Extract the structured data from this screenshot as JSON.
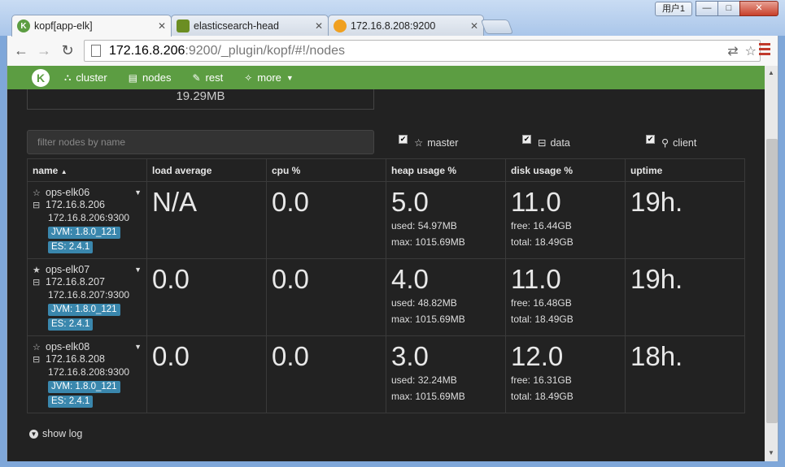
{
  "window": {
    "user_badge": "用户1",
    "minimize": "—",
    "maximize": "□",
    "close": "✕"
  },
  "tabs": [
    {
      "label": "kopf[app-elk]",
      "fav": "K",
      "fav_color": "#5c9d42"
    },
    {
      "label": "elasticsearch-head",
      "fav": "",
      "fav_color": "#6b8e23"
    },
    {
      "label": "172.16.8.208:9200",
      "fav": "",
      "fav_color": "#f0a020"
    }
  ],
  "address": {
    "host": "172.16.8.206",
    "rest": ":9200/_plugin/kopf/#!/nodes"
  },
  "nav": {
    "logo": "K",
    "items": [
      {
        "icon": "sitemap-icon",
        "label": "cluster"
      },
      {
        "icon": "nodes-icon",
        "label": "nodes"
      },
      {
        "icon": "rest-icon",
        "label": "rest"
      },
      {
        "icon": "wand-icon",
        "label": "more"
      }
    ]
  },
  "stat_value": "19.29MB",
  "filter": {
    "placeholder": "filter nodes by name"
  },
  "checkboxes": [
    {
      "label": "master",
      "checked": true
    },
    {
      "label": "data",
      "checked": true
    },
    {
      "label": "client",
      "checked": true
    }
  ],
  "table": {
    "headers": [
      "name",
      "load average",
      "cpu %",
      "heap usage %",
      "disk usage %",
      "uptime"
    ],
    "sort_indicator": "▲",
    "rows": [
      {
        "name": "ops-elk06",
        "master": false,
        "ip": "172.16.8.206",
        "address": "172.16.8.206:9300",
        "jvm": "JVM: 1.8.0_121",
        "es": "ES: 2.4.1",
        "load": "N/A",
        "cpu": "0.0",
        "heap": "5.0",
        "heap_used": "used: 54.97MB",
        "heap_max": "max: 1015.69MB",
        "disk": "11.0",
        "disk_free": "free: 16.44GB",
        "disk_total": "total: 18.49GB",
        "uptime": "19h."
      },
      {
        "name": "ops-elk07",
        "master": true,
        "ip": "172.16.8.207",
        "address": "172.16.8.207:9300",
        "jvm": "JVM: 1.8.0_121",
        "es": "ES: 2.4.1",
        "load": "0.0",
        "cpu": "0.0",
        "heap": "4.0",
        "heap_used": "used: 48.82MB",
        "heap_max": "max: 1015.69MB",
        "disk": "11.0",
        "disk_free": "free: 16.48GB",
        "disk_total": "total: 18.49GB",
        "uptime": "19h."
      },
      {
        "name": "ops-elk08",
        "master": false,
        "ip": "172.16.8.208",
        "address": "172.16.8.208:9300",
        "jvm": "JVM: 1.8.0_121",
        "es": "ES: 2.4.1",
        "load": "0.0",
        "cpu": "0.0",
        "heap": "3.0",
        "heap_used": "used: 32.24MB",
        "heap_max": "max: 1015.69MB",
        "disk": "12.0",
        "disk_free": "free: 16.31GB",
        "disk_total": "total: 18.49GB",
        "uptime": "18h."
      }
    ]
  },
  "show_log": "show log"
}
